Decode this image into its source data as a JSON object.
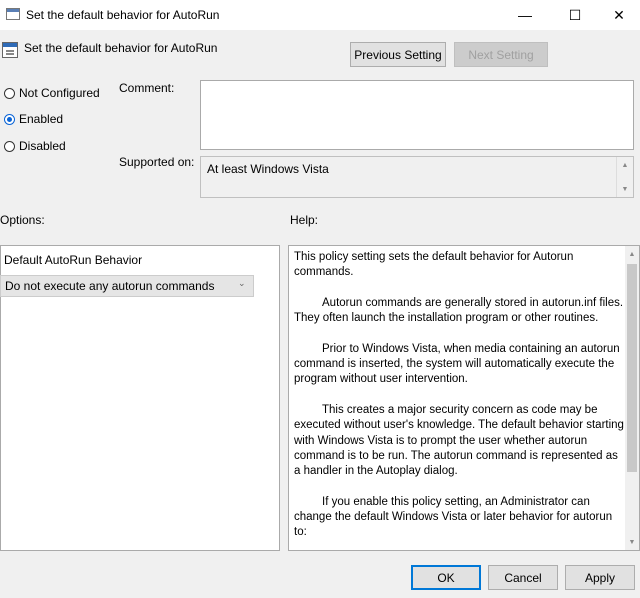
{
  "window": {
    "title": "Set the default behavior for AutoRun",
    "controls": {
      "minimize": "—",
      "maximize": "☐",
      "close": "✕"
    }
  },
  "header": {
    "title": "Set the default behavior for AutoRun",
    "previous_label": "Previous Setting",
    "next_label": "Next Setting"
  },
  "state": {
    "options": [
      {
        "label": "Not Configured",
        "selected": false
      },
      {
        "label": "Enabled",
        "selected": true
      },
      {
        "label": "Disabled",
        "selected": false
      }
    ]
  },
  "comment": {
    "label": "Comment:",
    "value": ""
  },
  "supported": {
    "label": "Supported on:",
    "value": "At least Windows Vista"
  },
  "options_section": {
    "label": "Options:",
    "field_label": "Default AutoRun Behavior",
    "selected_value": "Do not execute any autorun commands"
  },
  "help_section": {
    "label": "Help:",
    "paragraphs": [
      "This policy setting sets the default behavior for Autorun commands.",
      "Autorun commands are generally stored in autorun.inf files. They often launch the installation program or other routines.",
      "Prior to Windows Vista, when media containing an autorun command is inserted, the system will automatically execute the program without user intervention.",
      "This creates a major security concern as code may be executed without user's knowledge. The default behavior starting with Windows Vista is to prompt the user whether autorun command is to be run. The autorun command is represented as a handler in the Autoplay dialog.",
      "If you enable this policy setting, an Administrator can change the default Windows Vista or later behavior for autorun to:"
    ]
  },
  "footer": {
    "ok": "OK",
    "cancel": "Cancel",
    "apply": "Apply"
  },
  "icons": [
    "policy-icon",
    "scroll-up-icon",
    "scroll-down-icon",
    "chevron-down-icon"
  ],
  "colors": {
    "accent": "#0078d7",
    "background": "#f0f0f0"
  }
}
